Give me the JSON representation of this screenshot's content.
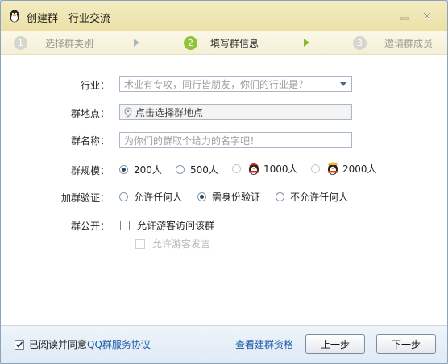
{
  "window": {
    "title": "创建群 - 行业交流",
    "minimize_icon": "minimize-icon",
    "close_icon": "close-icon"
  },
  "steps": [
    {
      "num": "1",
      "label": "选择群类别",
      "state": "inactive"
    },
    {
      "num": "2",
      "label": "填写群信息",
      "state": "active"
    },
    {
      "num": "3",
      "label": "邀请群成员",
      "state": "inactive"
    }
  ],
  "form": {
    "industry": {
      "label": "行业：",
      "placeholder": "术业有专攻，同行皆朋友，你们的行业是？"
    },
    "location": {
      "label": "群地点：",
      "placeholder": "点击选择群地点"
    },
    "name": {
      "label": "群名称：",
      "placeholder": "为你们的群取个给力的名字吧！"
    },
    "size": {
      "label": "群规模：",
      "options": [
        {
          "label": "200人",
          "checked": true
        },
        {
          "label": "500人",
          "checked": false
        },
        {
          "label": "1000人",
          "checked": false,
          "icon": "penguin-red-icon"
        },
        {
          "label": "2000人",
          "checked": false,
          "icon": "penguin-yellow-icon"
        }
      ]
    },
    "verify": {
      "label": "加群验证：",
      "options": [
        {
          "label": "允许任何人",
          "checked": false
        },
        {
          "label": "需身份验证",
          "checked": true
        },
        {
          "label": "不允许任何人",
          "checked": false
        }
      ]
    },
    "public": {
      "label": "群公开：",
      "visitor_access": {
        "label": "允许游客访问该群",
        "checked": false
      },
      "visitor_post": {
        "label": "允许游客发言",
        "checked": false,
        "disabled": true
      }
    }
  },
  "footer": {
    "agree_prefix": "已阅读并同意",
    "agree_link": "QQ群服务协议",
    "agree_checked": true,
    "qualification_link": "查看建群资格",
    "prev_button": "上一步",
    "next_button": "下一步"
  },
  "colors": {
    "titlebar": "#ece0a6",
    "active_step": "#8ec33a",
    "link": "#1e5aa8"
  }
}
